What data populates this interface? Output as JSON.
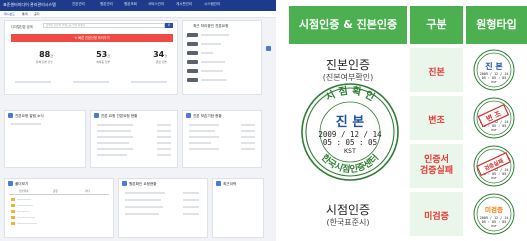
{
  "dashboard": {
    "app_title": "표준센터미디어 관리관리시스템",
    "nav_items": [
      "진본관리",
      "원본관리",
      "원본조회",
      "서비스관리",
      "게시판관리",
      "시스템관리"
    ],
    "sub_tabs": [
      "대시보드",
      "통계",
      "공지"
    ],
    "search": {
      "label": "디지털진본 검색",
      "placeholder": "검색할 진본의 키워드를 입력 하세요",
      "button": "검색"
    },
    "register_button": "✎ 빠른 진본신청 하러가기",
    "stats": [
      {
        "value": "88",
        "unit": "건",
        "label": "전체 진본 건수"
      },
      {
        "value": "53",
        "unit": "건",
        "label": "처리중 진본"
      },
      {
        "value": "34",
        "unit": "건",
        "label": "완료 진본"
      }
    ],
    "recent_panel_title": "최근 처리중인 진본요청",
    "notice_panel_title": "진본요청 알림 소식",
    "mid_panel_title": "진본 요청 진본요청 현황",
    "right_panel_title": "진본 보존기한 현황",
    "folder_panel_title": "폴더보기",
    "folder_tabs": [
      "진본목록",
      "공유",
      "기타"
    ],
    "bottom_mid_title": "원본확인 요청현황",
    "bottom_right_title": "최근이력",
    "folder_items": [
      "진본관리",
      "원본관리",
      "제출자료",
      "스캔문서",
      "증빙자료 목록"
    ]
  },
  "stamp_table": {
    "header_left": "시점인증 & 진본인증",
    "header_mid": "구분",
    "header_right": "원형타입",
    "top_title": "진본인증",
    "top_subtitle": "(진본여부확인)",
    "bottom_title": "시점인증",
    "bottom_subtitle": "(한국표준시)",
    "main_stamp": {
      "top_arc": "시 점 확 인",
      "bottom_arc": "한국시점인증센터",
      "date": "2009 / 12 / 14",
      "time": "05 : 05 : 05",
      "zone": "KST",
      "center": "진 본"
    },
    "rows": [
      {
        "label": "진본",
        "stamp_center": "진 본",
        "stamp_date": "2009 / 12 / 14",
        "stamp_time": "05 : 05 : 05",
        "stamp_zone": "KST"
      },
      {
        "label": "변조",
        "stamp_center": "변 조",
        "stamp_date": "2009 / 12 / 14",
        "stamp_time": "05 : 05 : 05",
        "stamp_zone": "KST"
      },
      {
        "label": "인증서\n검증실패",
        "stamp_center": "검증실패",
        "stamp_date": "2009 / 12 / 14",
        "stamp_time": "05 : 05 : 05",
        "stamp_zone": "KST"
      },
      {
        "label": "미검증",
        "stamp_center": "미검증",
        "stamp_date": "2009 / 12 / 14",
        "stamp_time": "05 : 05 : 05",
        "stamp_zone": "KST"
      }
    ],
    "colors": {
      "header_green": "#4caf50",
      "stamp_green": "#2e7d32",
      "stamp_blue": "#1e4fa8",
      "stamp_red": "#d32f2f",
      "label_red": "#e53935"
    }
  }
}
